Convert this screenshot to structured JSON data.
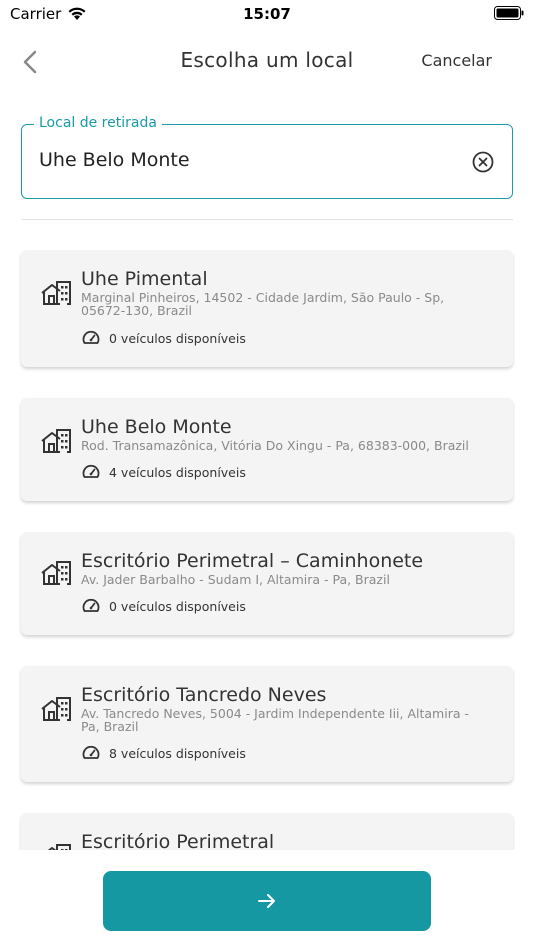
{
  "status_bar": {
    "carrier": "Carrier",
    "time": "15:07"
  },
  "nav": {
    "title": "Escolha um local",
    "cancel_label": "Cancelar"
  },
  "search": {
    "label": "Local de retirada",
    "value": "Uhe Belo Monte"
  },
  "locations": [
    {
      "name": "Uhe Pimental",
      "address": "Marginal Pinheiros, 14502 - Cidade Jardim, São Paulo - Sp, 05672-130, Brazil",
      "availability": "0 veículos disponíveis"
    },
    {
      "name": "Uhe Belo Monte",
      "address": "Rod. Transamazônica, Vitória Do Xingu - Pa, 68383-000, Brazil",
      "availability": "4 veículos disponíveis"
    },
    {
      "name": "Escritório Perimetral – Caminhonete",
      "address": "Av. Jader Barbalho - Sudam I, Altamira - Pa, Brazil",
      "availability": "0 veículos disponíveis"
    },
    {
      "name": "Escritório Tancredo Neves",
      "address": "Av. Tancredo Neves, 5004 - Jardim Independente Iii, Altamira - Pa, Brazil",
      "availability": "8 veículos disponíveis"
    },
    {
      "name": "Escritório Perimetral"
    }
  ],
  "icons": {
    "location": "building-icon",
    "availability": "gauge-icon",
    "next": "arrow-right-icon"
  },
  "colors": {
    "accent": "#1a9ba6",
    "button": "#1698a3",
    "card": "#f4f4f4"
  }
}
